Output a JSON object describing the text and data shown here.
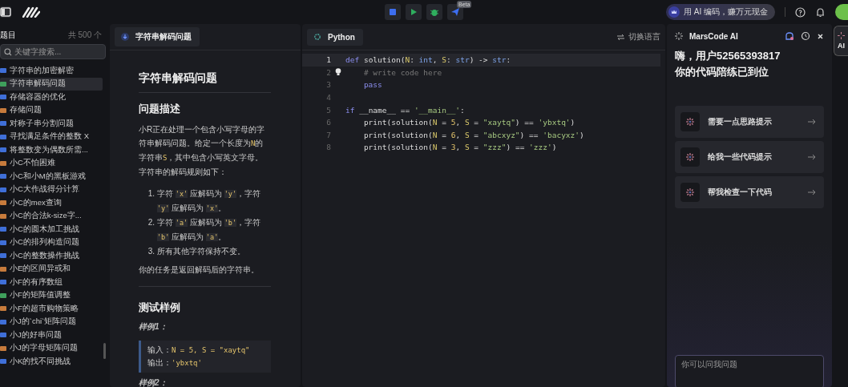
{
  "toolbar": {
    "beta_badge": "Beta",
    "promo": "用 AI 编码，赚万元现金"
  },
  "sidebar": {
    "title": "题目",
    "count": "共 500 个",
    "search": {
      "placeholder": "关键字搜索..."
    },
    "items": [
      {
        "label": "字符串的加密解密",
        "color": "#3f6fd8",
        "selected": false
      },
      {
        "label": "字符串解码问题",
        "color": "#3fa05c",
        "selected": true
      },
      {
        "label": "存储容器的优化",
        "color": "#3f6fd8",
        "selected": false
      },
      {
        "label": "存储问题",
        "color": "#c77b3c",
        "selected": false
      },
      {
        "label": "对称子串分割问题",
        "color": "#3f6fd8",
        "selected": false
      },
      {
        "label": "寻找满足条件的整数 X",
        "color": "#3f6fd8",
        "selected": false
      },
      {
        "label": "将整数变为偶数所需...",
        "color": "#3f6fd8",
        "selected": false
      },
      {
        "label": "小C不怕困难",
        "color": "#c77b3c",
        "selected": false
      },
      {
        "label": "小C和小M的黑板游戏",
        "color": "#3f6fd8",
        "selected": false
      },
      {
        "label": "小C大作战得分计算",
        "color": "#3f6fd8",
        "selected": false
      },
      {
        "label": "小C的mex查询",
        "color": "#c77b3c",
        "selected": false
      },
      {
        "label": "小C的合法k-size字...",
        "color": "#c77b3c",
        "selected": false
      },
      {
        "label": "小C的圆木加工挑战",
        "color": "#3f6fd8",
        "selected": false
      },
      {
        "label": "小C的排列构造问题",
        "color": "#3f6fd8",
        "selected": false
      },
      {
        "label": "小C的整数操作挑战",
        "color": "#3f6fd8",
        "selected": false
      },
      {
        "label": "小E的区间异或和",
        "color": "#c77b3c",
        "selected": false
      },
      {
        "label": "小F的有序数组",
        "color": "#3f6fd8",
        "selected": false
      },
      {
        "label": "小F的矩阵值调整",
        "color": "#3fa05c",
        "selected": false
      },
      {
        "label": "小F的超市购物策略",
        "color": "#c77b3c",
        "selected": false
      },
      {
        "label": "小J的`chi`矩阵问题",
        "color": "#3f6fd8",
        "selected": false
      },
      {
        "label": "小J的好串问题",
        "color": "#3f6fd8",
        "selected": false
      },
      {
        "label": "小J的字母矩阵问题",
        "color": "#c77b3c",
        "selected": false
      },
      {
        "label": "小K的找不同挑战",
        "color": "#3f6fd8",
        "selected": false
      }
    ]
  },
  "problem": {
    "tab": "字符串解码问题",
    "title": "字符串解码问题",
    "section_description": "问题描述",
    "description": [
      {
        "kind": "text",
        "text": "小R正在处理一个包含小写字母的字符串解码问题。给定一个长度为"
      },
      {
        "kind": "code",
        "text": "N"
      },
      {
        "kind": "text",
        "text": "的字符串"
      },
      {
        "kind": "code",
        "text": "S"
      },
      {
        "kind": "text",
        "text": "，其中包含小写英文字母。字符串的解码规则如下："
      }
    ],
    "rules": [
      {
        "marker": "1.",
        "parts": [
          {
            "kind": "text",
            "text": "字符 "
          },
          {
            "kind": "code",
            "text": "'x'"
          },
          {
            "kind": "text",
            "text": " 应解码为 "
          },
          {
            "kind": "code",
            "text": "'y'"
          },
          {
            "kind": "text",
            "text": "，字符 "
          },
          {
            "kind": "code",
            "text": "'y'"
          },
          {
            "kind": "text",
            "text": " 应解码为 "
          },
          {
            "kind": "code",
            "text": "'x'"
          },
          {
            "kind": "text",
            "text": "。"
          }
        ]
      },
      {
        "marker": "2.",
        "parts": [
          {
            "kind": "text",
            "text": "字符 "
          },
          {
            "kind": "code",
            "text": "'a'"
          },
          {
            "kind": "text",
            "text": " 应解码为 "
          },
          {
            "kind": "code",
            "text": "'b'"
          },
          {
            "kind": "text",
            "text": "，字符 "
          },
          {
            "kind": "code",
            "text": "'b'"
          },
          {
            "kind": "text",
            "text": " 应解码为 "
          },
          {
            "kind": "code",
            "text": "'a'"
          },
          {
            "kind": "text",
            "text": "。"
          }
        ]
      },
      {
        "marker": "3.",
        "parts": [
          {
            "kind": "text",
            "text": "所有其他字符保持不变。"
          }
        ]
      }
    ],
    "task": "你的任务是返回解码后的字符串。",
    "section_samples": "测试样例",
    "samples": [
      {
        "label": "样例1：",
        "input_label": "输入：",
        "input": "N = 5, S = \"xaytq\"",
        "output_label": "输出：",
        "output": "'ybxtq'"
      },
      {
        "label": "样例2："
      }
    ]
  },
  "editor": {
    "language": "Python",
    "switch_label": "切换语言",
    "lines": [
      {
        "number": "1",
        "code": "def solution(N: int, S: str) -> str:",
        "active": true
      },
      {
        "number": "2",
        "code": "    # write code here",
        "active": false
      },
      {
        "number": "3",
        "code": "    pass",
        "active": false
      },
      {
        "number": "4",
        "active": false
      },
      {
        "number": "5",
        "code": "if __name__ == '__main__':",
        "active": false
      },
      {
        "number": "6",
        "code": "    print(solution(N = 5, S = \"xaytq\") == 'ybxtq')",
        "active": false
      },
      {
        "number": "7",
        "code": "    print(solution(N = 6, S = \"abcxyz\") == 'bacyxz')",
        "active": false
      },
      {
        "number": "8",
        "code": "    print(solution(N = 3, S = \"zzz\") == 'zzz')",
        "active": false
      }
    ]
  },
  "assistant": {
    "title": "MarsCode AI",
    "greeting": "嗨，用户52565393817",
    "subtitle": "你的代码陪练已到位",
    "suggestions": [
      "需要一点思路提示",
      "给我一些代码提示",
      "帮我检查一下代码"
    ],
    "input": {
      "placeholder": "你可以问我问题"
    }
  },
  "rail": {
    "tab": "AI"
  }
}
